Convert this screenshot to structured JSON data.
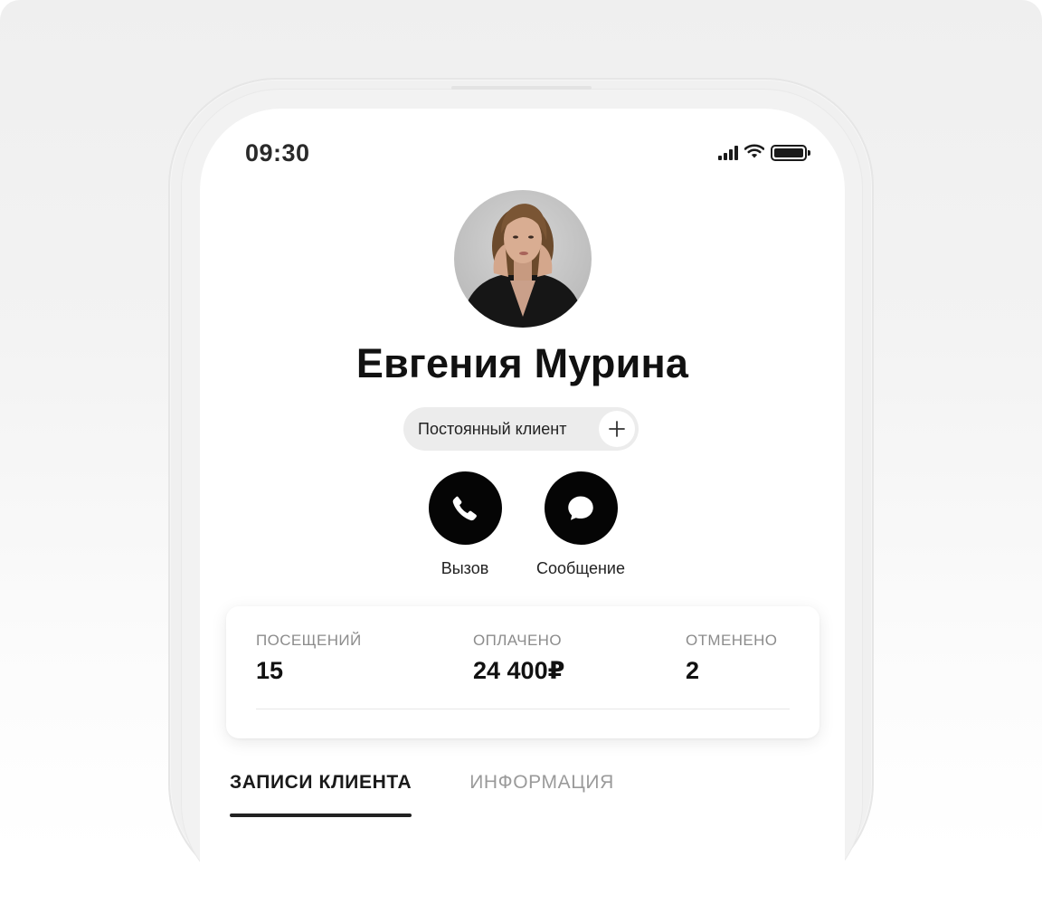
{
  "status_bar": {
    "time": "09:30",
    "icons": [
      "signal-icon",
      "wifi-icon",
      "battery-icon"
    ]
  },
  "profile": {
    "name": "Евгения Мурина",
    "tag_label": "Постоянный клиент",
    "tag_add_icon": "plus-icon"
  },
  "actions": [
    {
      "label": "Вызов",
      "icon": "phone-icon"
    },
    {
      "label": "Сообщение",
      "icon": "chat-bubble-icon"
    }
  ],
  "stats": [
    {
      "caption": "ПОСЕЩЕНИЙ",
      "value": "15"
    },
    {
      "caption": "ОПЛАЧЕНО",
      "value": "24 400₽"
    },
    {
      "caption": "ОТМЕНЕНО",
      "value": "2"
    }
  ],
  "tabs": [
    {
      "label": "ЗАПИСИ КЛИЕНТА",
      "active": true
    },
    {
      "label": "ИНФОРМАЦИЯ",
      "active": false
    }
  ],
  "colors": {
    "primary": "#050505",
    "tag_bg": "#ececec",
    "caption": "#8c8c8c"
  }
}
